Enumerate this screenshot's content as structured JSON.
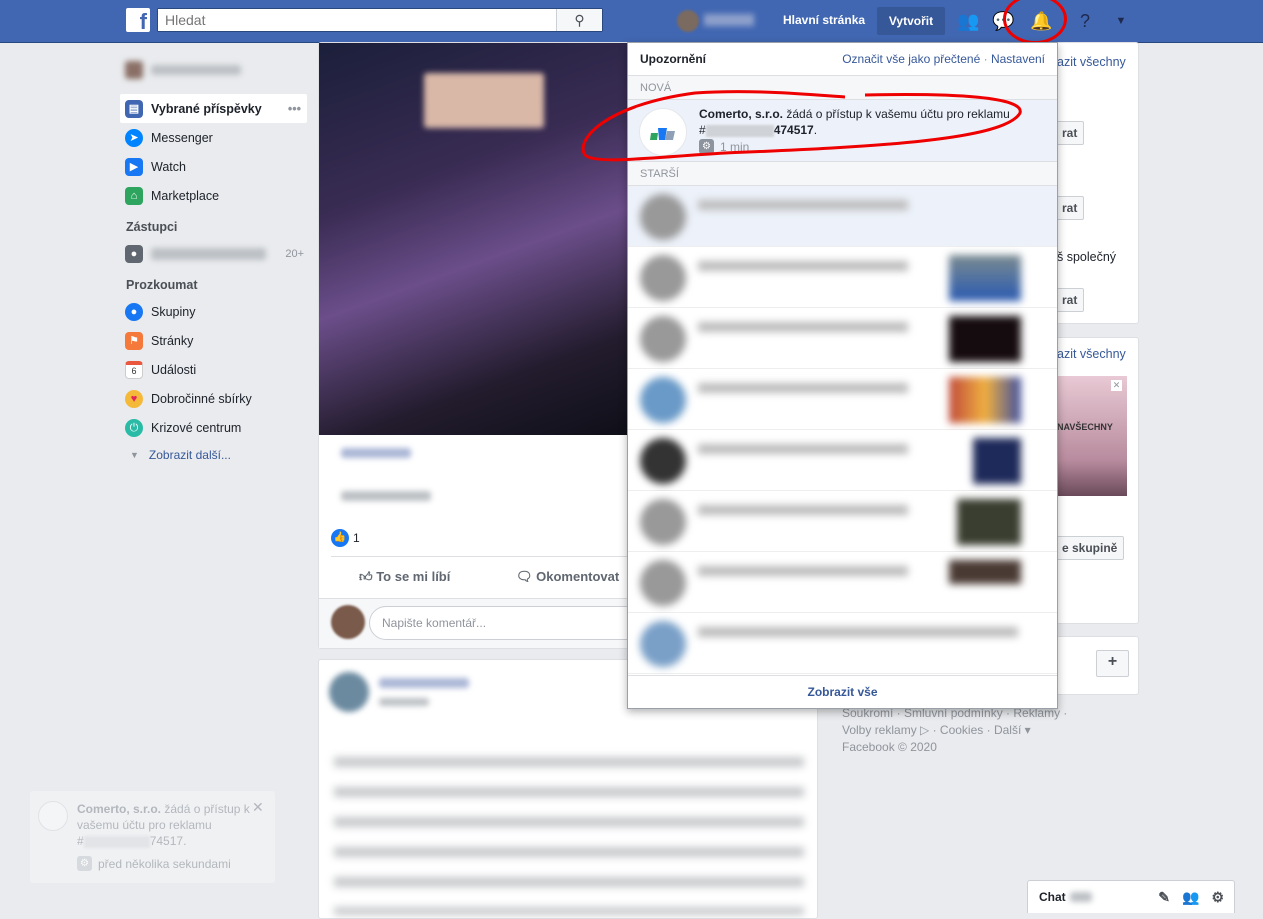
{
  "topbar": {
    "logo": "f",
    "search_placeholder": "Hledat",
    "home": "Hlavní stránka",
    "create": "Vytvořit"
  },
  "sidebar": {
    "items": [
      {
        "label": "Vybrané příspěvky",
        "icon": "news-feed-icon",
        "color": "#4267b2"
      },
      {
        "label": "Messenger",
        "icon": "messenger-icon",
        "color": "#0084ff"
      },
      {
        "label": "Watch",
        "icon": "watch-icon",
        "color": "#1877f2"
      },
      {
        "label": "Marketplace",
        "icon": "marketplace-icon",
        "color": "#2ea55e"
      }
    ],
    "shortcuts_heading": "Zástupci",
    "shortcut_count": "20+",
    "explore_heading": "Prozkoumat",
    "explore": [
      {
        "label": "Skupiny",
        "icon": "groups-icon",
        "color": "#1877f2"
      },
      {
        "label": "Stránky",
        "icon": "pages-flag-icon",
        "color": "#f5793a"
      },
      {
        "label": "Události",
        "icon": "events-calendar-icon",
        "color": "#e9573f"
      },
      {
        "label": "Dobročinné sbírky",
        "icon": "fundraisers-icon",
        "color": "#f5b93a"
      },
      {
        "label": "Krizové centrum",
        "icon": "crisis-response-icon",
        "color": "#2abba7"
      }
    ],
    "more": "Zobrazit další..."
  },
  "post": {
    "likes": "1",
    "like": "To se mi líbí",
    "comment": "Okomentovat",
    "comment_placeholder": "Napište komentář..."
  },
  "notifications": {
    "title": "Upozornění",
    "mark_all": "Označit vše jako přečtené",
    "separator": "·",
    "settings": "Nastavení",
    "new_heading": "NOVÁ",
    "old_heading": "STARŠÍ",
    "new_item": {
      "sender": "Comerto, s.r.o.",
      "text": " žádá o přístup k vašemu účtu pro reklamu",
      "prefix": "#",
      "suffix": "474517",
      "period": ".",
      "time": "1 min"
    },
    "see_all": "Zobrazit vše"
  },
  "right": {
    "see_all_1": "azit všechny",
    "btn": "rat",
    "common": "š společný",
    "see_all_2": "azit všechny",
    "ad_text": "NAVŠECHNY",
    "group_btn": "e skupině",
    "plus": "+"
  },
  "footer": {
    "line1": "Soukromí · Smluvní podmínky · Reklamy ·",
    "line2": "Volby reklamy ▷ · Cookies · Další ▾",
    "line3": "Facebook © 2020"
  },
  "toast": {
    "sender": "Comerto, s.r.o.",
    "text": " žádá o přístup k vašemu účtu pro reklamu",
    "prefix": "#",
    "suffix": "74517",
    "period": ".",
    "time": "před několika sekundami",
    "close": "✕"
  },
  "chat": {
    "label": "Chat"
  }
}
